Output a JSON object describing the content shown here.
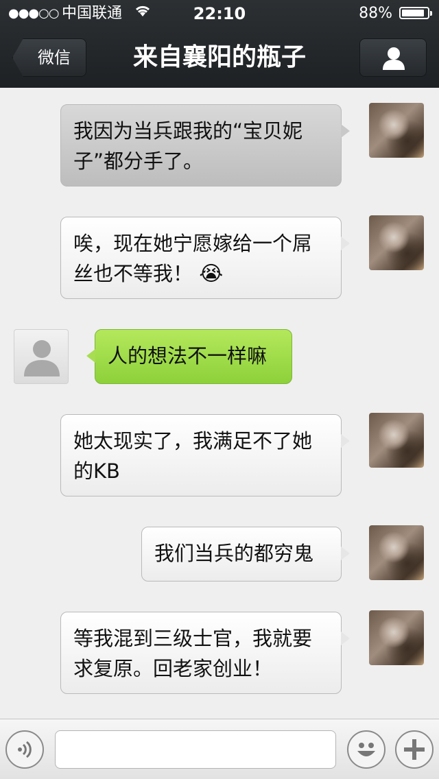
{
  "status_bar": {
    "signal": "●●●○○",
    "carrier": "中国联通",
    "time": "22:10",
    "battery": "88%",
    "battery_level": 0.88
  },
  "nav": {
    "back_label": "微信",
    "title": "来自襄阳的瓶子"
  },
  "messages": [
    {
      "side": "right",
      "text": "我因为当兵跟我的“宝贝妮子”都分手了。"
    },
    {
      "side": "right",
      "text": "唉，现在她宁愿嫁给一个屌丝也不等我！",
      "emoji": "😭"
    },
    {
      "side": "left",
      "text": "人的想法不一样嘛"
    },
    {
      "side": "right",
      "text": "她太现实了，我满足不了她的KB"
    },
    {
      "side": "right",
      "text": "我们当兵的都穷鬼"
    },
    {
      "side": "right",
      "text": "等我混到三级士官，我就要求复原。回老家创业！"
    }
  ],
  "input": {
    "value": "",
    "placeholder": ""
  },
  "colors": {
    "nav_bg": "#25292c",
    "chat_bg": "#efefef",
    "green_bubble": "#9ad944"
  },
  "icons": {
    "voice": "voice-icon",
    "emoji": "smiley-icon",
    "plus": "plus-icon",
    "profile": "person-icon"
  }
}
